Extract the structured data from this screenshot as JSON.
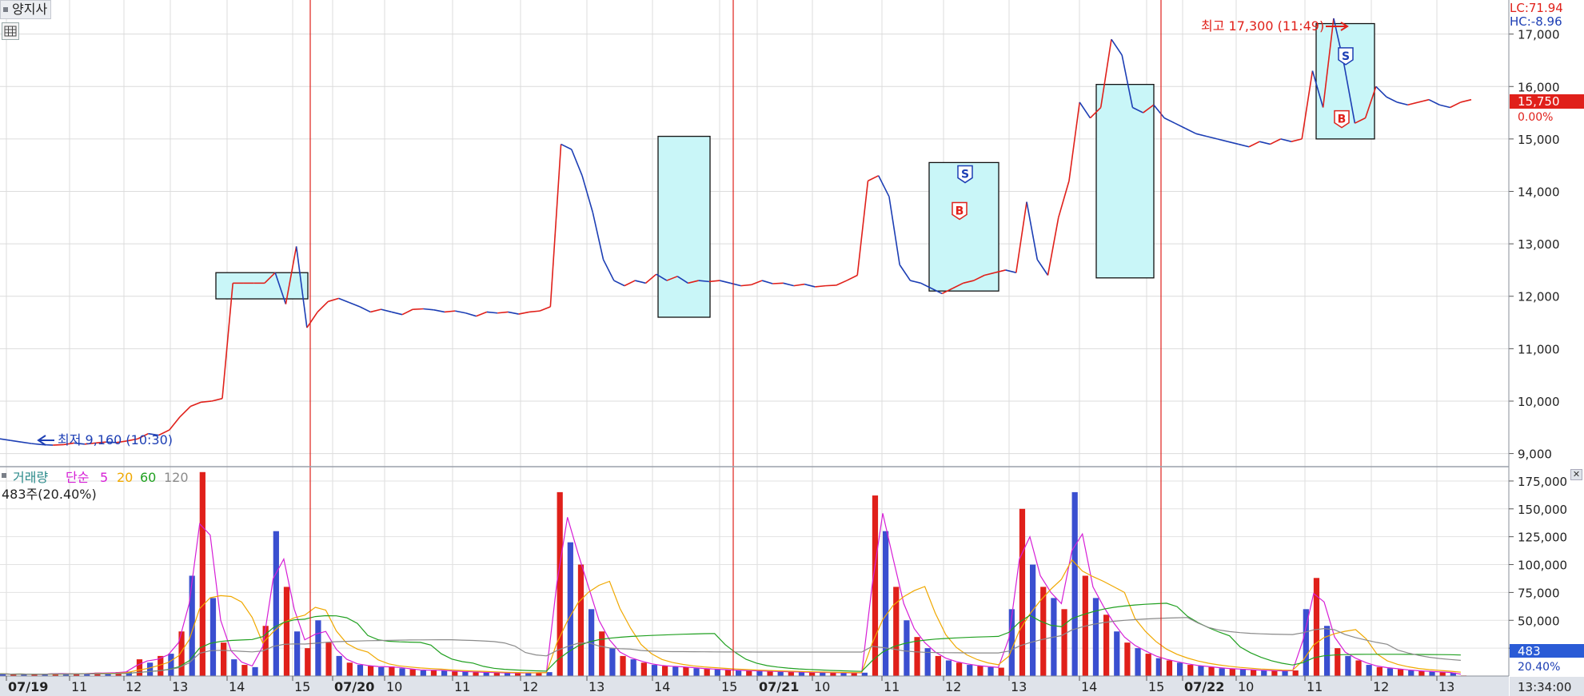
{
  "stock": {
    "name": "양지사"
  },
  "price_panel": {
    "lc_label": "LC:71.94",
    "hc_label": "HC:-8.96",
    "current_price": "15,750",
    "current_change": "0.00%",
    "high_note": "최고 17,300 (11:49)",
    "low_note": "최저 9,160 (10:30)",
    "markers": [
      "S",
      "B"
    ]
  },
  "volume_panel": {
    "legend": {
      "volume": "거래량",
      "simple": "단순",
      "ma5": "5",
      "ma20": "20",
      "ma60": "60",
      "ma120": "120"
    },
    "summary": "483주(20.40%)",
    "current_volume": "483",
    "current_percent": "20.40%"
  },
  "time_axis": {
    "labels": [
      "07/19",
      "11",
      "12",
      "13",
      "14",
      "15",
      "07/20",
      "10",
      "11",
      "12",
      "13",
      "14",
      "15",
      "07/21",
      "10",
      "11",
      "12",
      "13",
      "14",
      "15",
      "07/22",
      "10",
      "11",
      "12",
      "13"
    ],
    "current_time": "13:34:00"
  },
  "colors": {
    "up": "#e0201a",
    "down": "#1c3eb4",
    "box_fill": "#c9f6f8",
    "ma5": "#d61fd6",
    "ma20": "#f0a800",
    "ma60": "#20a020",
    "ma120": "#8a8a8a",
    "legend_volume": "#2a8a8a",
    "volume_bar": "#3a4fd0",
    "axis_bg": "#dfe3ea"
  },
  "chart_data": [
    {
      "type": "line",
      "title": "양지사",
      "y_ticks": [
        9000,
        10000,
        11000,
        12000,
        13000,
        14000,
        15000,
        16000,
        17000
      ],
      "ylim": [
        8750,
        17650
      ],
      "time_labels": [
        "07/19",
        "11",
        "12",
        "13",
        "14",
        "15",
        "07/20",
        "10",
        "11",
        "12",
        "13",
        "14",
        "15",
        "07/21",
        "10",
        "11",
        "12",
        "13",
        "14",
        "15",
        "07/22",
        "10",
        "11",
        "12",
        "13"
      ],
      "series": [
        {
          "values": [
            9280,
            9250,
            9220,
            9190,
            9170,
            9160,
            9170,
            9200,
            9180,
            9200,
            9220,
            9210,
            9240,
            9280,
            9380,
            9350,
            9450,
            9700,
            9900,
            9980,
            10000,
            10050,
            12250,
            12250,
            12250,
            12250,
            12450,
            11850,
            12950,
            11400,
            11700,
            11900,
            11960,
            11880,
            11800,
            11700,
            11750,
            11700,
            11650,
            11750,
            11760,
            11740,
            11700,
            11720,
            11680,
            11620,
            11700,
            11680,
            11700,
            11660,
            11700,
            11720,
            11800,
            14900,
            14800,
            14300,
            13600,
            12700,
            12300,
            12200,
            12300,
            12250,
            12420,
            12300,
            12380,
            12250,
            12300,
            12280,
            12300,
            12250,
            12200,
            12220,
            12300,
            12240,
            12250,
            12200,
            12230,
            12180,
            12200,
            12210,
            12300,
            12400,
            14200,
            14300,
            13900,
            12600,
            12300,
            12250,
            12150,
            12050,
            12150,
            12250,
            12300,
            12400,
            12450,
            12500,
            12450,
            13800,
            12700,
            12400,
            13500,
            14200,
            15700,
            15400,
            15600,
            16900,
            16600,
            15600,
            15500,
            15650,
            15400,
            15300,
            15200,
            15100,
            15050,
            15000,
            14950,
            14900,
            14850,
            14950,
            14900,
            15000,
            14950,
            15000,
            16300,
            15600,
            17300,
            16400,
            15300,
            15400,
            16000,
            15800,
            15700,
            15650,
            15700,
            15750,
            15650,
            15600,
            15700,
            15750
          ]
        }
      ],
      "annotations": [
        "최고 17,300 (11:49)",
        "최저 9,160 (10:30)"
      ],
      "lc": "LC:71.94",
      "hc": "HC:-8.96",
      "last_price": 15750,
      "last_change": "0.00%"
    },
    {
      "type": "bar",
      "title": "거래량",
      "y_ticks": [
        25000,
        50000,
        75000,
        100000,
        125000,
        150000,
        175000
      ],
      "ylim": [
        0,
        185000
      ],
      "legend": [
        "거래량",
        "단순 5",
        "20",
        "60",
        "120"
      ],
      "series": [
        {
          "name": "거래량",
          "values": [
            2000,
            1500,
            1800,
            1200,
            1600,
            2500,
            1800,
            2200,
            2000,
            3000,
            2500,
            3500,
            4000,
            15000,
            12000,
            18000,
            20000,
            40000,
            90000,
            183000,
            70000,
            30000,
            15000,
            10000,
            8000,
            45000,
            130000,
            80000,
            40000,
            25000,
            50000,
            30000,
            18000,
            12000,
            10000,
            9000,
            8000,
            8500,
            7000,
            6000,
            5000,
            5500,
            4800,
            4200,
            4000,
            3500,
            3300,
            3000,
            2800,
            2600,
            3000,
            2800,
            3500,
            165000,
            120000,
            100000,
            60000,
            40000,
            25000,
            18000,
            15000,
            12000,
            10000,
            9000,
            8500,
            8000,
            7000,
            6500,
            6000,
            5500,
            5000,
            4800,
            4500,
            4200,
            4000,
            3800,
            3500,
            3300,
            3200,
            3000,
            2900,
            2800,
            3000,
            162000,
            130000,
            80000,
            50000,
            35000,
            25000,
            18000,
            14000,
            12000,
            10000,
            9000,
            8000,
            7500,
            60000,
            150000,
            100000,
            80000,
            70000,
            60000,
            165000,
            90000,
            70000,
            55000,
            40000,
            30000,
            25000,
            20000,
            16000,
            14000,
            12000,
            10000,
            9000,
            8000,
            7000,
            6500,
            6000,
            5500,
            5000,
            4800,
            4500,
            5000,
            60000,
            88000,
            45000,
            25000,
            18000,
            14000,
            10000,
            8000,
            7000,
            6000,
            5000,
            4500,
            4000,
            3500,
            3000,
            483
          ]
        }
      ],
      "moving_averages": [
        {
          "name": "5",
          "color": "#d61fd6"
        },
        {
          "name": "20",
          "color": "#f0a800"
        },
        {
          "name": "60",
          "color": "#20a020"
        },
        {
          "name": "120",
          "color": "#8a8a8a"
        }
      ],
      "last_volume": 483,
      "last_percent": "20.40%"
    }
  ]
}
